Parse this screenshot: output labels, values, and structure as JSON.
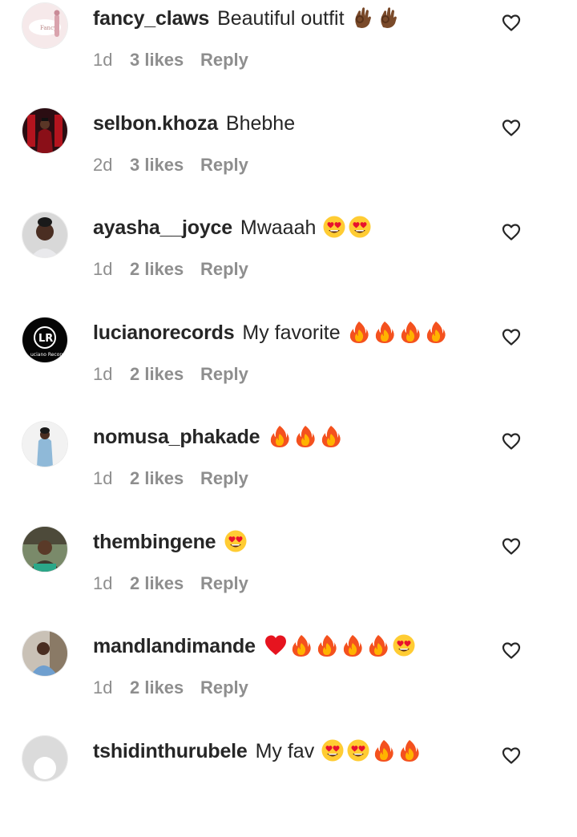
{
  "comments": [
    {
      "username": "fancy_claws",
      "text": "Beautiful outfit",
      "emojis": [
        "ok-hand",
        "ok-hand"
      ],
      "time": "1d",
      "likes": "3 likes",
      "reply": "Reply",
      "avatar": "fancy-claws-avatar"
    },
    {
      "username": "selbon.khoza",
      "text": "Bhebhe",
      "emojis": [],
      "time": "2d",
      "likes": "3 likes",
      "reply": "Reply",
      "avatar": "selbon-khoza-avatar"
    },
    {
      "username": "ayasha__joyce",
      "text": "Mwaaah",
      "emojis": [
        "heart-eyes",
        "heart-eyes"
      ],
      "time": "1d",
      "likes": "2 likes",
      "reply": "Reply",
      "avatar": "ayasha-joyce-avatar"
    },
    {
      "username": "lucianorecords",
      "text": "My favorite",
      "emojis": [
        "fire",
        "fire",
        "fire",
        "fire"
      ],
      "time": "1d",
      "likes": "2 likes",
      "reply": "Reply",
      "avatar": "luciano-records-logo"
    },
    {
      "username": "nomusa_phakade",
      "text": "",
      "emojis": [
        "fire",
        "fire",
        "fire"
      ],
      "time": "1d",
      "likes": "2 likes",
      "reply": "Reply",
      "avatar": "nomusa-phakade-avatar"
    },
    {
      "username": "thembingene",
      "text": "",
      "emojis": [
        "heart-eyes"
      ],
      "time": "1d",
      "likes": "2 likes",
      "reply": "Reply",
      "avatar": "thembingene-avatar"
    },
    {
      "username": "mandlandimande",
      "text": "",
      "emojis": [
        "red-heart",
        "fire",
        "fire",
        "fire",
        "fire",
        "heart-eyes"
      ],
      "time": "1d",
      "likes": "2 likes",
      "reply": "Reply",
      "avatar": "mandlandimande-avatar"
    },
    {
      "username": "tshidinthurubele",
      "text": "My fav",
      "emojis": [
        "heart-eyes",
        "heart-eyes",
        "fire",
        "fire"
      ],
      "time": "",
      "likes": "",
      "reply": "",
      "avatar": "default-avatar"
    }
  ],
  "colors": {
    "username": "#262626",
    "meta": "#8e8e8e",
    "heart_outline": "#262626"
  }
}
